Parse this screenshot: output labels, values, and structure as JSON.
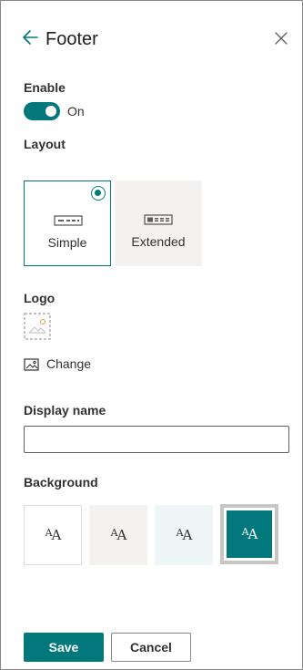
{
  "header": {
    "title": "Footer",
    "back_icon": "arrow-left-icon",
    "close_icon": "close-icon"
  },
  "enable": {
    "label": "Enable",
    "state_text": "On",
    "value": true
  },
  "layout": {
    "label": "Layout",
    "options": [
      {
        "label": "Simple",
        "selected": true,
        "icon": "simple-footer-icon"
      },
      {
        "label": "Extended",
        "selected": false,
        "icon": "extended-footer-icon"
      }
    ]
  },
  "logo": {
    "label": "Logo",
    "placeholder_icon": "image-placeholder-icon",
    "change_label": "Change",
    "change_icon": "change-image-icon"
  },
  "display_name": {
    "label": "Display name",
    "value": "",
    "placeholder": ""
  },
  "background": {
    "label": "Background",
    "swatches": [
      {
        "text": "AA",
        "bg": "#ffffff",
        "fg": "#323130",
        "selected": false
      },
      {
        "text": "AA",
        "bg": "#f3f2f1",
        "fg": "#323130",
        "selected": false
      },
      {
        "text": "AA",
        "bg": "#eff6f7",
        "fg": "#323130",
        "selected": false
      },
      {
        "text": "AA",
        "bg": "#03787c",
        "fg": "#ffffff",
        "selected": true
      }
    ]
  },
  "actions": {
    "save_label": "Save",
    "cancel_label": "Cancel"
  },
  "colors": {
    "accent": "#03787c",
    "text": "#323130",
    "border": "#8a8886"
  }
}
